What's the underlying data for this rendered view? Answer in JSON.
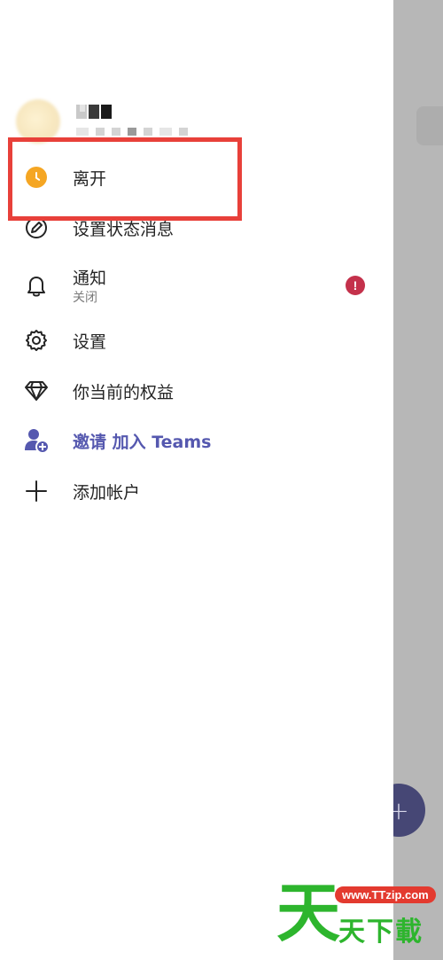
{
  "menu": {
    "away": {
      "label": "离开",
      "icon": "away-clock-icon",
      "status_color": "#f5a623"
    },
    "status_message": {
      "label": "设置状态消息",
      "icon": "edit-status-icon"
    },
    "notifications": {
      "label": "通知",
      "sublabel": "关闭",
      "icon": "bell-icon",
      "badge": "!"
    },
    "settings": {
      "label": "设置",
      "icon": "gear-icon"
    },
    "benefits": {
      "label": "你当前的权益",
      "icon": "diamond-icon"
    },
    "invite": {
      "label": "邀请 加入 Teams",
      "icon": "add-person-icon",
      "accent": "#5558af"
    },
    "add_account": {
      "label": "添加帐户",
      "icon": "plus-icon"
    }
  },
  "fab": {
    "symbol": "+"
  },
  "watermark": {
    "big": "天",
    "url": "www.TTzip.com",
    "text": "天下載"
  },
  "colors": {
    "highlight": "#e8403a",
    "badge": "#c4314b",
    "fab": "#464775",
    "backdrop": "#b7b7b7"
  }
}
